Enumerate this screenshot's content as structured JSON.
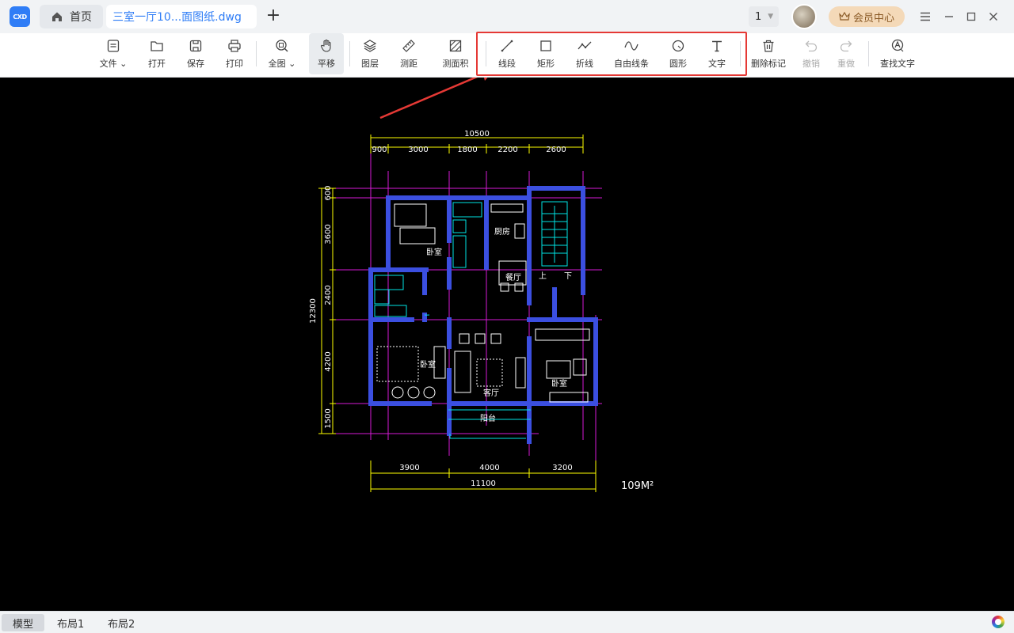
{
  "app": {
    "logo_text": "CXD"
  },
  "tabs": {
    "home_label": "首页",
    "file_label": "三室一厅10...面图纸.dwg",
    "add_label": "+"
  },
  "header": {
    "page_number": "1",
    "vip_label": "会员中心"
  },
  "toolbar": {
    "file": "文件",
    "open": "打开",
    "save": "保存",
    "print": "打印",
    "fullview": "全图",
    "pan": "平移",
    "layers": "图层",
    "measure_distance": "测距",
    "measure_area": "测面积",
    "line": "线段",
    "rectangle": "矩形",
    "polyline": "折线",
    "freehand": "自由线条",
    "circle": "圆形",
    "text": "文字",
    "delete_marks": "删除标记",
    "undo": "撤销",
    "redo": "重做",
    "find_text": "查找文字"
  },
  "drawing": {
    "dim_total_top": "10500",
    "dims_top": [
      "900",
      "3000",
      "1800",
      "2200",
      "2600"
    ],
    "dims_left": [
      "600",
      "3600",
      "2400",
      "4200",
      "1500"
    ],
    "dim_total_left": "12300",
    "dims_bottom": [
      "3900",
      "4000",
      "3200"
    ],
    "dim_total_bottom": "11100",
    "area_label": "109M²",
    "rooms": {
      "bedroom_top": "卧室",
      "kitchen": "厨房",
      "dining": "餐厅",
      "stairs_up": "上",
      "stairs_down": "下",
      "bedroom_left": "卧室",
      "living": "客厅",
      "bedroom_right": "卧室",
      "balcony": "阳台"
    }
  },
  "status": {
    "layouts": [
      "模型",
      "布局1",
      "布局2"
    ]
  },
  "colors": {
    "accent": "#2f7df6",
    "wall": "#3b4fe0",
    "grid": "#d61ad6",
    "dimension": "#ffff00",
    "fixture": "#00e5e5",
    "highlight": "#e53935"
  }
}
